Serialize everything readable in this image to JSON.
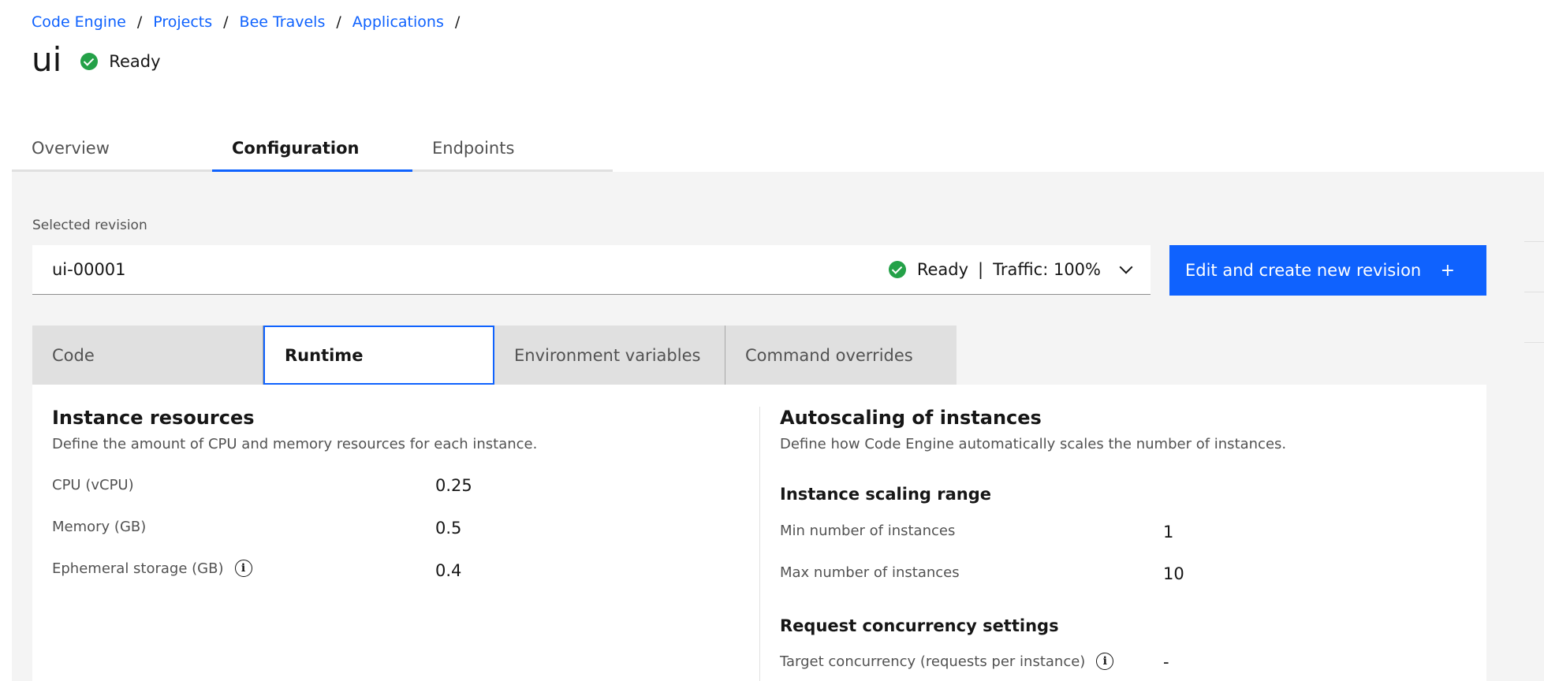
{
  "breadcrumb": [
    "Code Engine",
    "Projects",
    "Bee Travels",
    "Applications"
  ],
  "breadcrumb_separator": "/",
  "page": {
    "title": "ui",
    "status": "Ready"
  },
  "main_tabs": [
    "Overview",
    "Configuration",
    "Endpoints"
  ],
  "active_main_tab": "Configuration",
  "revision": {
    "label": "Selected revision",
    "value": "ui-00001",
    "status": "Ready",
    "divider": "|",
    "traffic": "Traffic: 100%"
  },
  "edit_button": {
    "label": "Edit and create new revision",
    "icon": "+"
  },
  "sub_tabs": [
    "Code",
    "Runtime",
    "Environment variables",
    "Command overrides"
  ],
  "active_sub_tab": "Runtime",
  "instance_resources": {
    "title": "Instance resources",
    "description": "Define the amount of CPU and memory resources for each instance.",
    "rows": [
      {
        "label": "CPU (vCPU)",
        "value": "0.25"
      },
      {
        "label": "Memory (GB)",
        "value": "0.5"
      },
      {
        "label": "Ephemeral storage (GB)",
        "value": "0.4",
        "info_icon": "i"
      }
    ]
  },
  "autoscaling": {
    "title": "Autoscaling of instances",
    "description": "Define how Code Engine automatically scales the number of instances.",
    "scaling_range_title": "Instance scaling range",
    "scaling_rows": [
      {
        "label": "Min number of instances",
        "value": "1"
      },
      {
        "label": "Max number of instances",
        "value": "10"
      }
    ],
    "concurrency_title": "Request concurrency settings",
    "concurrency_rows": [
      {
        "label": "Target concurrency (requests per instance)",
        "value": "-",
        "info_icon": "i"
      }
    ]
  },
  "colors": {
    "accent": "#0f62fe",
    "success": "#24a148",
    "background_gray": "#f4f4f4"
  }
}
